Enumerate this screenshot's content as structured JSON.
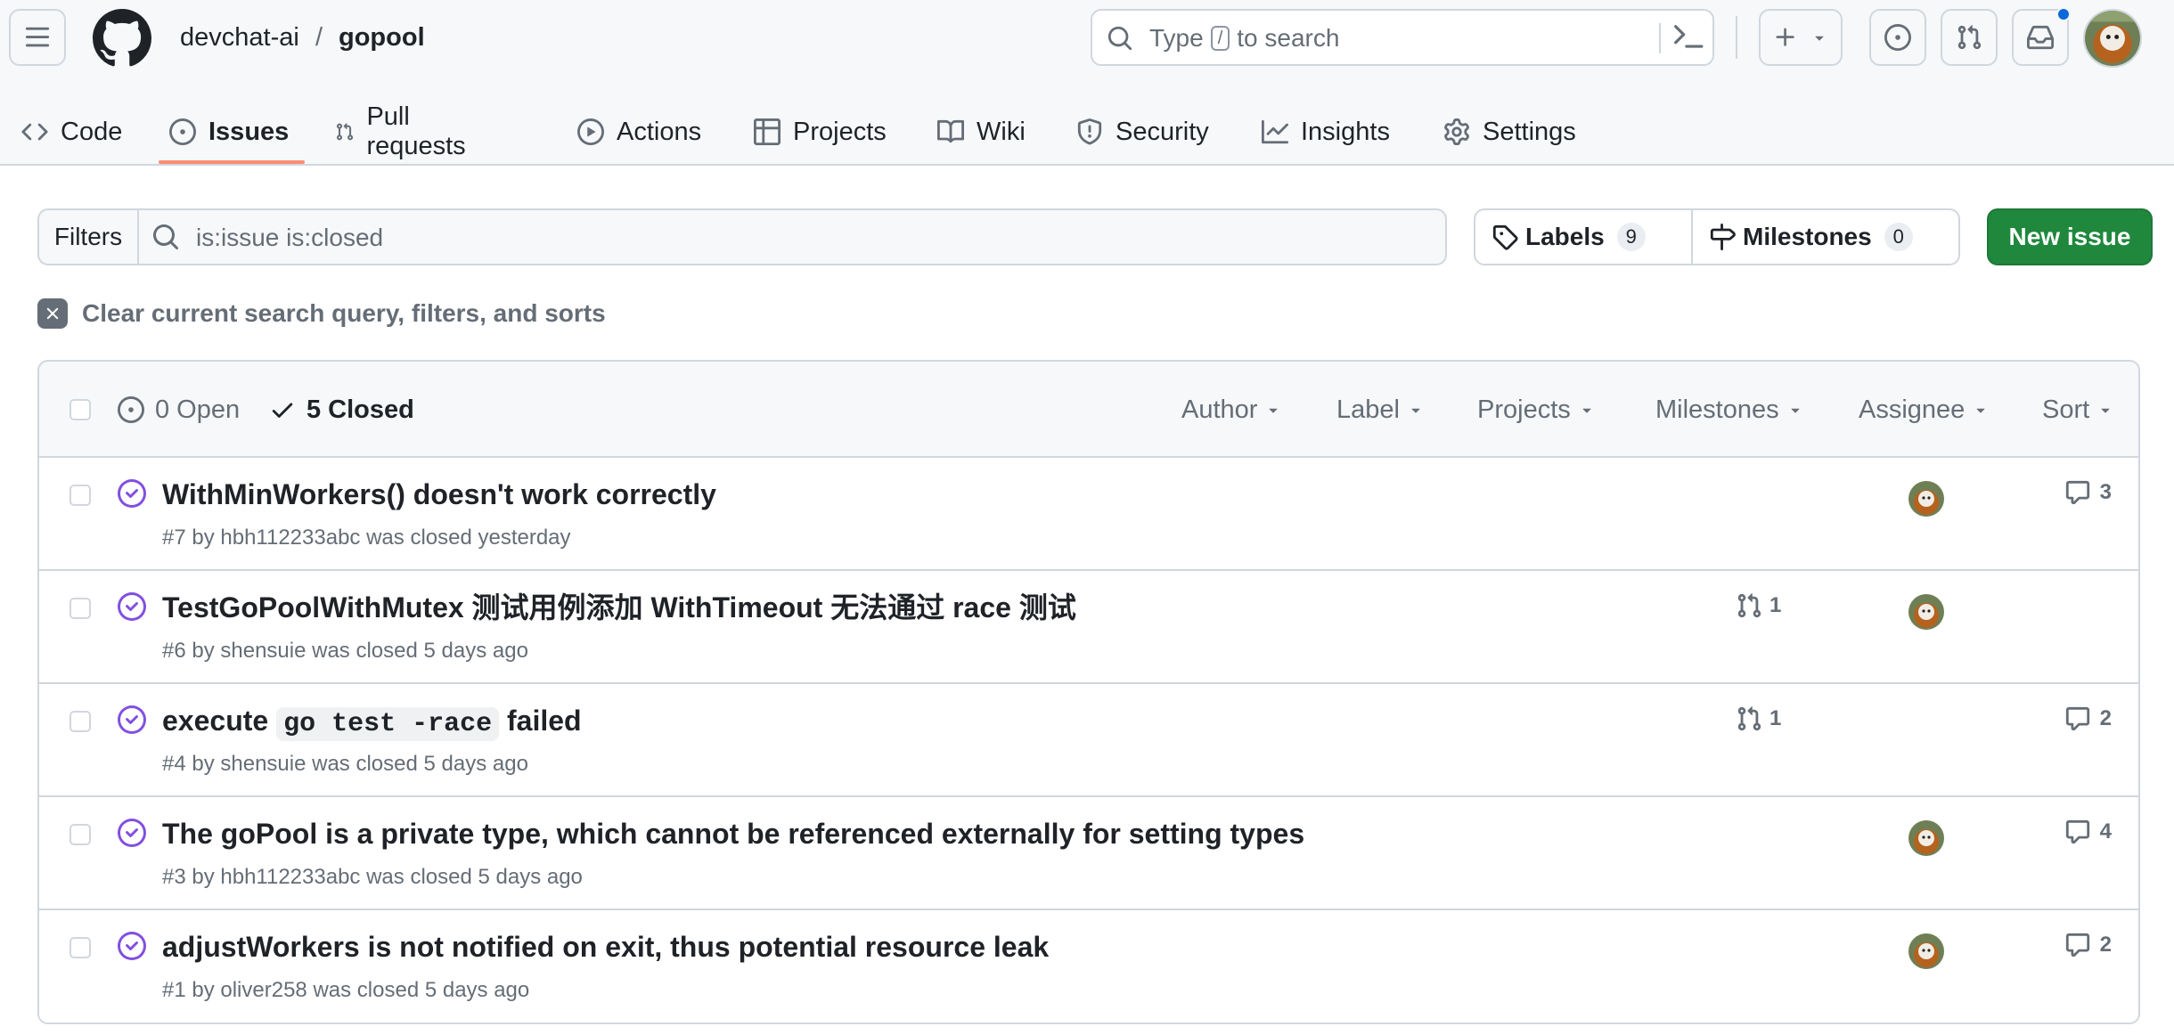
{
  "header": {
    "owner": "devchat-ai",
    "separator": "/",
    "repo": "gopool",
    "search_prefix": "Type",
    "search_key": "/",
    "search_suffix": "to search"
  },
  "tabs": [
    {
      "label": "Code",
      "icon": "code-icon"
    },
    {
      "label": "Issues",
      "icon": "issue-opened-icon",
      "selected": true
    },
    {
      "label": "Pull requests",
      "icon": "git-pull-request-icon"
    },
    {
      "label": "Actions",
      "icon": "play-icon"
    },
    {
      "label": "Projects",
      "icon": "table-icon"
    },
    {
      "label": "Wiki",
      "icon": "book-icon"
    },
    {
      "label": "Security",
      "icon": "shield-icon"
    },
    {
      "label": "Insights",
      "icon": "graph-icon"
    },
    {
      "label": "Settings",
      "icon": "gear-icon"
    }
  ],
  "filters": {
    "button_label": "Filters",
    "query": "is:issue is:closed",
    "labels_label": "Labels",
    "labels_count": "9",
    "milestones_label": "Milestones",
    "milestones_count": "0",
    "new_issue_label": "New issue",
    "clear_label": "Clear current search query, filters, and sorts"
  },
  "list_header": {
    "open_label": "0 Open",
    "closed_label": "5 Closed",
    "filters": [
      "Author",
      "Label",
      "Projects",
      "Milestones",
      "Assignee",
      "Sort"
    ]
  },
  "issues": [
    {
      "title": "WithMinWorkers() doesn't work correctly",
      "meta": "#7 by hbh112233abc was closed yesterday",
      "pr_count": "",
      "has_assignee": true,
      "comments": "3"
    },
    {
      "title": "TestGoPoolWithMutex 测试用例添加 WithTimeout 无法通过 race 测试",
      "meta": "#6 by shensuie was closed 5 days ago",
      "pr_count": "1",
      "has_assignee": true,
      "comments": ""
    },
    {
      "title_before": "execute",
      "title_code": "go test -race",
      "title_after": "failed",
      "meta": "#4 by shensuie was closed 5 days ago",
      "pr_count": "1",
      "has_assignee": false,
      "comments": "2"
    },
    {
      "title": "The goPool is a private type, which cannot be referenced externally for setting types",
      "meta": "#3 by hbh112233abc was closed 5 days ago",
      "pr_count": "",
      "has_assignee": true,
      "comments": "4"
    },
    {
      "title": "adjustWorkers is not notified on exit, thus potential resource leak",
      "meta": "#1 by oliver258 was closed 5 days ago",
      "pr_count": "",
      "has_assignee": true,
      "comments": "2"
    }
  ],
  "colors": {
    "accent_green": "#1f883d",
    "closed_purple": "#8250df",
    "tab_underline": "#fd8c73",
    "notification_blue": "#0969da"
  }
}
